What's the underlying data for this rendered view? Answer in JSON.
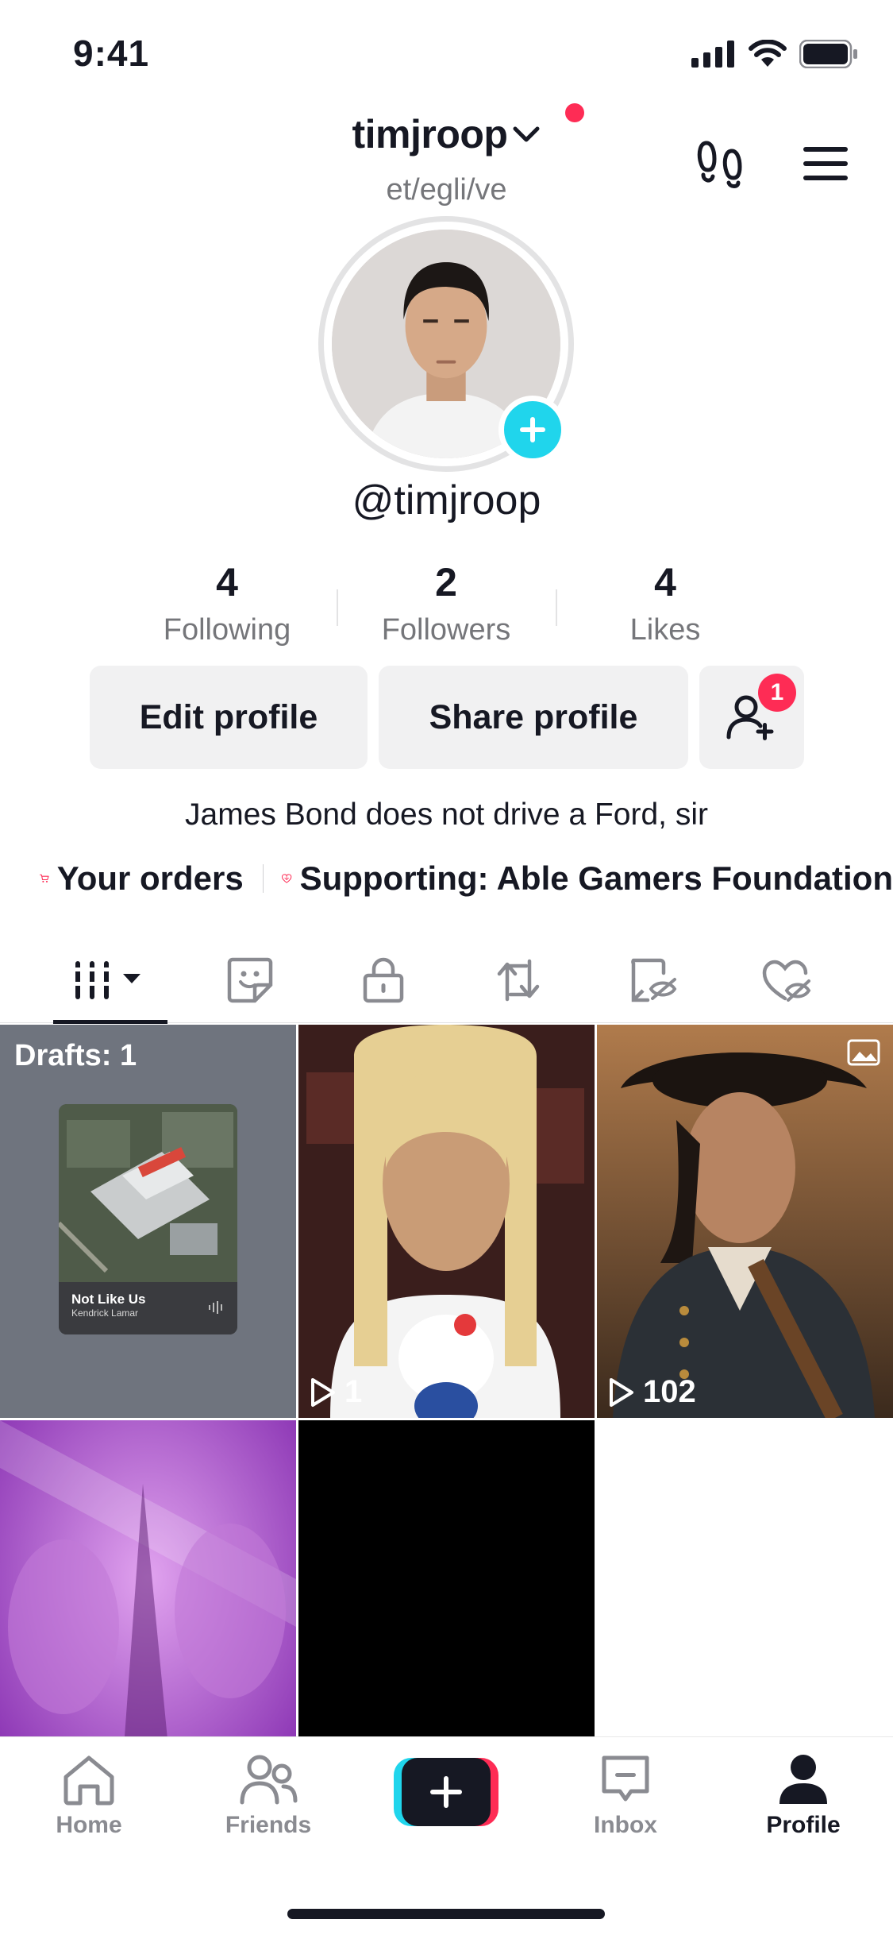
{
  "status_bar": {
    "time": "9:41"
  },
  "header": {
    "username": "timjroop",
    "pronouns": "et/egli/ve",
    "handle": "@timjroop"
  },
  "stats": [
    {
      "value": "4",
      "label": "Following"
    },
    {
      "value": "2",
      "label": "Followers"
    },
    {
      "value": "4",
      "label": "Likes"
    }
  ],
  "actions": {
    "edit_profile": "Edit profile",
    "share_profile": "Share profile",
    "add_friends_badge": "1"
  },
  "bio": "James Bond does not drive a Ford, sir",
  "links": {
    "orders": "Your orders",
    "supporting": "Supporting: Able Gamers Foundation"
  },
  "tabs": [
    {
      "icon": "grid-icon",
      "active": true
    },
    {
      "icon": "sticker-icon"
    },
    {
      "icon": "lock-icon"
    },
    {
      "icon": "repost-icon"
    },
    {
      "icon": "hidden-video-icon"
    },
    {
      "icon": "hidden-heart-icon"
    }
  ],
  "grid": {
    "drafts_label": "Drafts: 1",
    "draft_music_title": "Not Like Us",
    "draft_music_artist": "Kendrick Lamar",
    "videos": [
      {
        "views": "1"
      },
      {
        "views": "102"
      }
    ]
  },
  "bottom_nav": {
    "home": "Home",
    "friends": "Friends",
    "inbox": "Inbox",
    "profile": "Profile"
  },
  "colors": {
    "accent_red": "#fe2c55",
    "accent_cyan": "#20d5ec",
    "text_primary": "#161823",
    "text_secondary": "#75767a"
  }
}
